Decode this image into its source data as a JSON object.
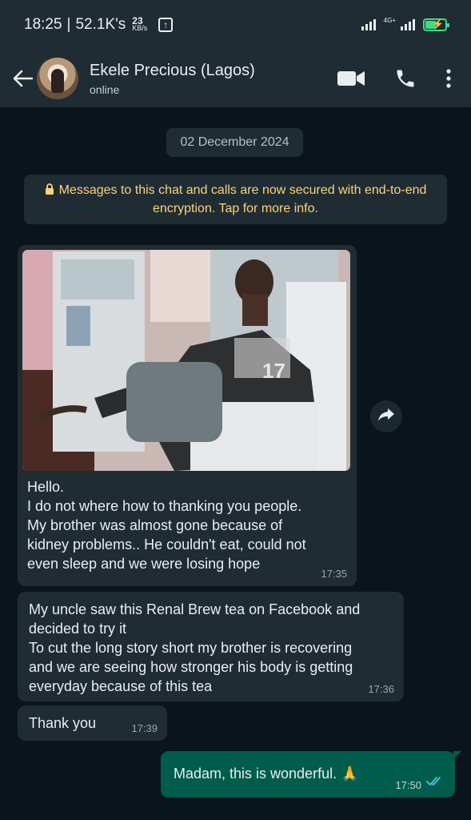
{
  "status_bar": {
    "time": "18:25",
    "separator": "|",
    "data_usage": "52.1K's",
    "speed_value": "23",
    "speed_unit": "KB/s",
    "network_label": "4G+",
    "battery_color": "#3ddc84"
  },
  "header": {
    "contact_name": "Ekele Precious (Lagos)",
    "contact_status": "online",
    "icons": [
      "back-arrow-icon",
      "video-call-icon",
      "phone-call-icon",
      "more-options-icon"
    ]
  },
  "chat": {
    "date_label": "02 December 2024",
    "encryption_notice": "Messages to this chat and calls are now secured with end-to-end encryption. Tap for more info.",
    "messages": [
      {
        "direction": "incoming",
        "has_image": true,
        "text": "Hello.\nI do not where how to thanking you people.\nMy brother was almost gone because of\nkidney problems.. He couldn't eat, could not\neven sleep and we were losing hope",
        "time": "17:35"
      },
      {
        "direction": "incoming",
        "text": "My uncle saw this Renal Brew tea on Facebook and\ndecided to try it\nTo cut the long story short my brother is recovering\nand we are seeing how stronger his body is getting\neveryday because of this tea",
        "time": "17:36"
      },
      {
        "direction": "incoming",
        "text": "Thank you",
        "time": "17:39"
      },
      {
        "direction": "outgoing",
        "text": "Madam, this is wonderful. 🙏",
        "time": "17:50",
        "read_ticks_color": "#53bdeb"
      }
    ]
  },
  "colors": {
    "background": "#0b141a",
    "header": "#1f2c34",
    "incoming_bubble": "#1f2c34",
    "outgoing_bubble": "#005c4b",
    "encryption_text": "#ffd279"
  }
}
